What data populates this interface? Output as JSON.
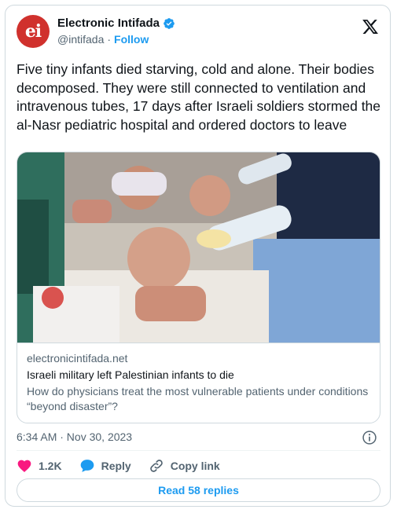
{
  "author": {
    "display_name": "Electronic Intifada",
    "handle": "@intifada",
    "separator": "·",
    "follow_label": "Follow",
    "avatar_text": "ei"
  },
  "tweet": {
    "text": "Five tiny infants died starving, cold and alone. Their bodies decomposed. They were still connected to ventilation and intravenous tubes, 17 days after Israeli soldiers stormed the al-Nasr pediatric hospital and ordered doctors to leave"
  },
  "link_card": {
    "domain": "electronicintifada.net",
    "title": "Israeli military left Palestinian infants to die",
    "description": "How do physicians treat the most vulnerable patients under conditions “beyond disaster”?"
  },
  "meta": {
    "timestamp": "6:34 AM · Nov 30, 2023"
  },
  "actions": {
    "likes": "1.2K",
    "reply_label": "Reply",
    "copy_link_label": "Copy link",
    "read_replies_label": "Read 58 replies"
  },
  "colors": {
    "accent": "#1d9bf0",
    "like": "#f91880",
    "avatar_bg": "#d0312d"
  },
  "icons": [
    "verified-badge-icon",
    "x-logo-icon",
    "info-icon",
    "heart-icon",
    "reply-bubble-icon",
    "link-icon"
  ]
}
